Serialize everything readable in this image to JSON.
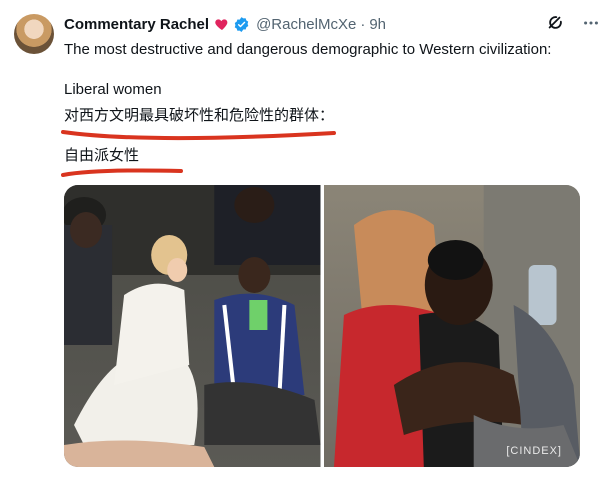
{
  "tweet": {
    "author_name": "Commentary Rachel",
    "handle": "@RachelMcXe",
    "separator": "·",
    "time": "9h",
    "text_line1": "The most destructive and dangerous demographic to Western civilization:",
    "text_line2": "Liberal women",
    "text_line3": "对西方文明最具破坏性和危险性的群体：",
    "text_line4": "自由派女性"
  },
  "icons": {
    "heart": "red-heart-icon",
    "verified": "verified-badge-icon",
    "grok": "grok-icon",
    "more": "more-options-icon"
  },
  "media": {
    "photo1_alt": "",
    "photo2_alt": ""
  },
  "watermark": "[CINDEX]",
  "colors": {
    "accent": "#1d9bf0",
    "underline": "#d9341f",
    "muted": "#536471"
  }
}
